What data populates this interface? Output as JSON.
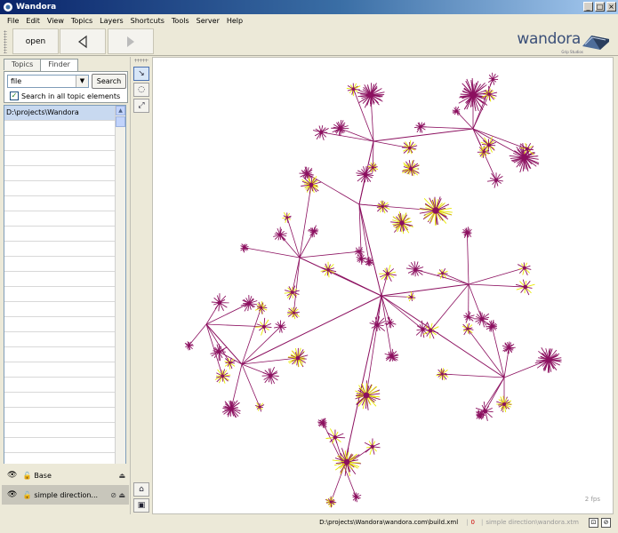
{
  "window": {
    "title": "Wandora"
  },
  "menu": [
    "File",
    "Edit",
    "View",
    "Topics",
    "Layers",
    "Shortcuts",
    "Tools",
    "Server",
    "Help"
  ],
  "toolbar": {
    "open_label": "open",
    "back_icon": "back-arrow-icon",
    "forward_icon": "forward-arrow-icon"
  },
  "logo": {
    "text": "wandora",
    "sub": "Grip Studios"
  },
  "left": {
    "tabs": [
      "Topics",
      "Finder"
    ],
    "active_tab": "Finder",
    "search_value": "file",
    "search_button": "Search",
    "search_all_label": "Search in all topic elements",
    "search_all_checked": true,
    "results": [
      "D:\\projects\\Wandora"
    ]
  },
  "layers": [
    {
      "name": "Base",
      "controls": "⏏"
    },
    {
      "name": "simple direction...",
      "controls": "⊘ ⏏"
    }
  ],
  "tools": [
    "select-tool-icon",
    "lasso-tool-icon",
    "edge-tool-icon"
  ],
  "tools_bottom": [
    "zoom-fit-icon",
    "screenshot-icon"
  ],
  "canvas": {
    "fps": "2 fps",
    "node_color": "#8b0f5f",
    "highlight_color": "#e8e800"
  },
  "status": {
    "path": "D:\\projects\\Wandora\\wandora.com\\build.xml",
    "count": "0",
    "layer": "simple direction\\wandora.xtm"
  }
}
